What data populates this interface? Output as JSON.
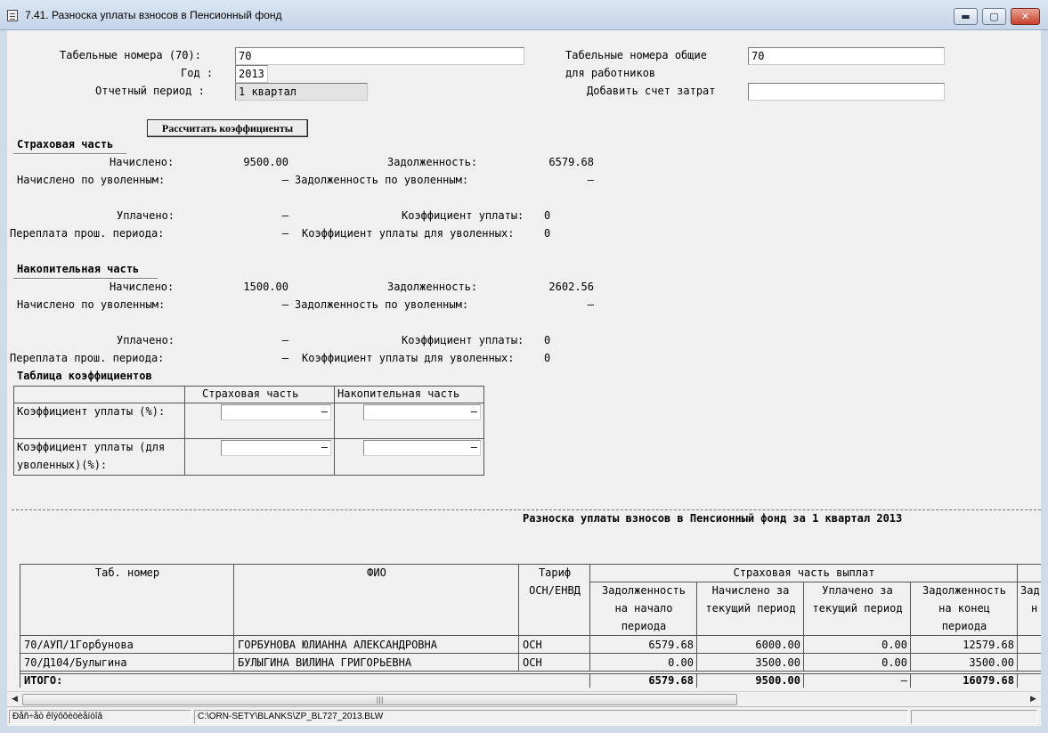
{
  "window": {
    "title": "7.41. Разноска уплаты взносов в Пенсионный фонд",
    "min_symbol": "▬",
    "max_symbol": "▢",
    "close_symbol": "✕"
  },
  "form": {
    "tab_numbers_label": "Табельные номера (70):",
    "tab_numbers_value": "70",
    "year_label": "Год :",
    "year_value": "2013",
    "period_label": "Отчетный период :",
    "period_value": "1 квартал",
    "tab_numbers_common_label_1": "Табельные номера общие",
    "tab_numbers_common_label_2": "для работников",
    "tab_numbers_common_value": "70",
    "add_cost_account_label": "Добавить счет затрат",
    "add_cost_account_value": "",
    "calc_button_label": "Рассчитать коэффициенты"
  },
  "insurance": {
    "heading": "Страховая часть",
    "accrued_label": "Начислено:",
    "accrued_value": "9500.00",
    "debt_label": "Задолженность:",
    "debt_value": "6579.68",
    "accrued_dismissed_label": "Начислено по уволенным:",
    "accrued_dismissed_value": "–",
    "debt_dismissed_label": "Задолженность по уволенным:",
    "debt_dismissed_value": "–",
    "paid_label": "Уплачено:",
    "paid_value": "–",
    "pay_coef_label": "Коэффициент уплаты:",
    "pay_coef_value": "0",
    "overpay_label": "Переплата прош. периода:",
    "overpay_value": "–",
    "pay_coef_dismissed_label": "Коэффициент уплаты для уволенных:",
    "pay_coef_dismissed_value": "0"
  },
  "funded": {
    "heading": "Накопительная часть",
    "accrued_label": "Начислено:",
    "accrued_value": "1500.00",
    "debt_label": "Задолженность:",
    "debt_value": "2602.56",
    "accrued_dismissed_label": "Начислено по уволенным:",
    "accrued_dismissed_value": "–",
    "debt_dismissed_label": "Задолженность по уволенным:",
    "debt_dismissed_value": "–",
    "paid_label": "Уплачено:",
    "paid_value": "–",
    "pay_coef_label": "Коэффициент уплаты:",
    "pay_coef_value": "0",
    "overpay_label": "Переплата прош. периода:",
    "overpay_value": "–",
    "pay_coef_dismissed_label": "Коэффициент уплаты для уволенных:",
    "pay_coef_dismissed_value": "0"
  },
  "coef_table": {
    "title": "Таблица коэффициентов",
    "col_insurance": "Страховая часть",
    "col_funded": "Накопительная часть",
    "row1_label": "Коэффициент уплаты (%):",
    "row2_label_1": "Коэффициент уплаты (для",
    "row2_label_2": "уволенных)(%):",
    "row1_insurance": "–",
    "row1_funded": "–",
    "row2_insurance": "–",
    "row2_funded": "–"
  },
  "report": {
    "title": "Разноска уплаты взносов в Пенсионный фонд за 1 квартал 2013",
    "headers": {
      "tab_number": "Таб. номер",
      "fio": "ФИО",
      "tariff_1": "Тариф",
      "tariff_2": "ОСН/ЕНВД",
      "group_insurance": "Страховая часть выплат",
      "debt_start_1": "Задолженность",
      "debt_start_2": "на начало",
      "debt_start_3": "периода",
      "accrued_1": "Начислено за",
      "accrued_2": "текущий период",
      "paid_1": "Уплачено за",
      "paid_2": "текущий период",
      "debt_end_1": "Задолженность",
      "debt_end_2": "на конец",
      "debt_end_3": "периода",
      "next_1": "Зад",
      "next_2": "н"
    },
    "rows": [
      {
        "tab": "70/АУП/1Горбунова",
        "fio": "ГОРБУНОВА ЮЛИАННА АЛЕКСАНДРОВНА",
        "tariff": "ОСН",
        "debt_start": "6579.68",
        "accrued": "6000.00",
        "paid": "0.00",
        "debt_end": "12579.68"
      },
      {
        "tab": "70/Д104/Булыгина",
        "fio": "БУЛЫГИНА ВИЛИНА ГРИГОРЬЕВНА",
        "tariff": "ОСН",
        "debt_start": "0.00",
        "accrued": "3500.00",
        "paid": "0.00",
        "debt_end": "3500.00"
      }
    ],
    "total": {
      "label": "ИТОГО:",
      "debt_start": "6579.68",
      "accrued": "9500.00",
      "paid": "–",
      "debt_end": "16079.68"
    }
  },
  "scrollbar": {
    "left_arrow": "◀",
    "right_arrow": "▶",
    "thumb_grip": "|||"
  },
  "statusbar": {
    "pane1": "Ðåñ÷åò êîýôôèöèåíòîâ",
    "pane2": "C:\\ORN-SETY\\BLANKS\\ZP_BL727_2013.BLW"
  }
}
